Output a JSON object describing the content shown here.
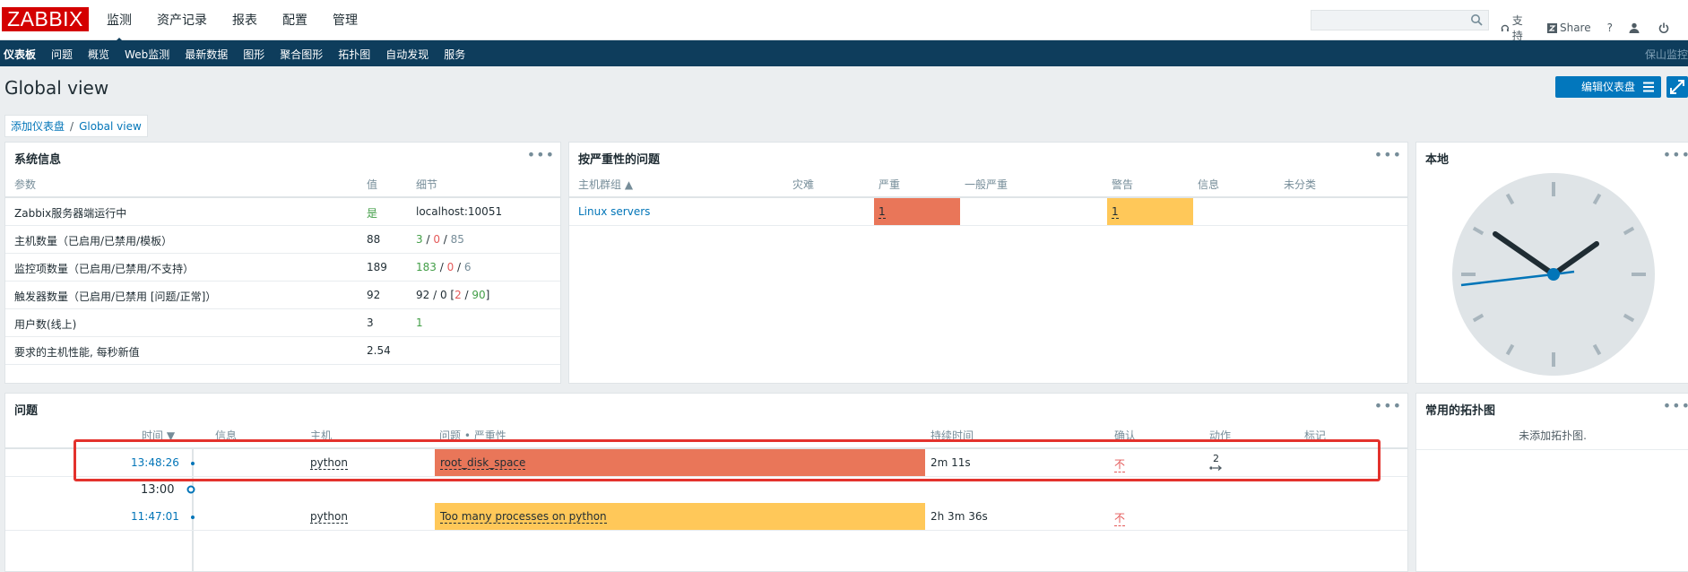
{
  "header": {
    "logo": "ZABBIX",
    "menu": [
      "监测",
      "资产记录",
      "报表",
      "配置",
      "管理"
    ],
    "active_menu": "监测",
    "links": {
      "support": "支持",
      "share": "Share",
      "help": "?"
    }
  },
  "submenu": {
    "items": [
      "仪表板",
      "问题",
      "概览",
      "Web监测",
      "最新数据",
      "图形",
      "聚合图形",
      "拓扑图",
      "自动发现",
      "服务"
    ],
    "active": "仪表板",
    "right_text": "保山监控"
  },
  "page": {
    "title": "Global view",
    "edit_button": "编辑仪表盘",
    "breadcrumb": [
      "添加仪表盘",
      "Global view"
    ]
  },
  "sysinfo": {
    "title": "系统信息",
    "headers": [
      "参数",
      "值",
      "细节"
    ],
    "rows": [
      {
        "param": "Zabbix服务器端运行中",
        "value": "是",
        "detail": "localhost:10051"
      },
      {
        "param": "主机数量（已启用/已禁用/模板）",
        "value": "88",
        "d1": "3",
        "d2": "0",
        "d3": "85"
      },
      {
        "param": "监控项数量（已启用/已禁用/不支持）",
        "value": "189",
        "d1": "183",
        "d2": "0",
        "d3": "6"
      },
      {
        "param": "触发器数量（已启用/已禁用 [问题/正常]）",
        "value": "92",
        "d_prefix": "92 / 0 [",
        "d1": "2",
        "d2": "90",
        "d_suffix": "]"
      },
      {
        "param": "用户数(线上)",
        "value": "3",
        "d1": "1"
      },
      {
        "param": "要求的主机性能, 每秒新值",
        "value": "2.54"
      }
    ]
  },
  "severity_problems": {
    "title": "按严重性的问题",
    "headers": [
      "主机群组 ▲",
      "灾难",
      "严重",
      "一般严重",
      "警告",
      "信息",
      "未分类"
    ],
    "rows": [
      {
        "group": "Linux servers",
        "high": "1",
        "warning": "1"
      }
    ],
    "colors": {
      "high": "#e97659",
      "warning": "#ffc859"
    }
  },
  "local_clock": {
    "title": "本地"
  },
  "problems": {
    "title": "问题",
    "headers": [
      "时间 ▼",
      "信息",
      "主机",
      "问题 • 严重性",
      "持续时间",
      "确认",
      "动作",
      "标记"
    ],
    "rows": [
      {
        "time": "13:48:26",
        "host": "python",
        "problem": "root_disk_space",
        "duration": "2m 11s",
        "ack": "不",
        "actions": "2",
        "color": "#e97659"
      },
      {
        "time": "11:47:01",
        "host": "python",
        "problem": "Too many processes on python",
        "duration": "2h 3m 36s",
        "ack": "不",
        "color": "#ffc859"
      }
    ],
    "time_marker": "13:00"
  },
  "maps": {
    "title": "常用的拓扑图",
    "empty": "未添加拓扑图."
  }
}
